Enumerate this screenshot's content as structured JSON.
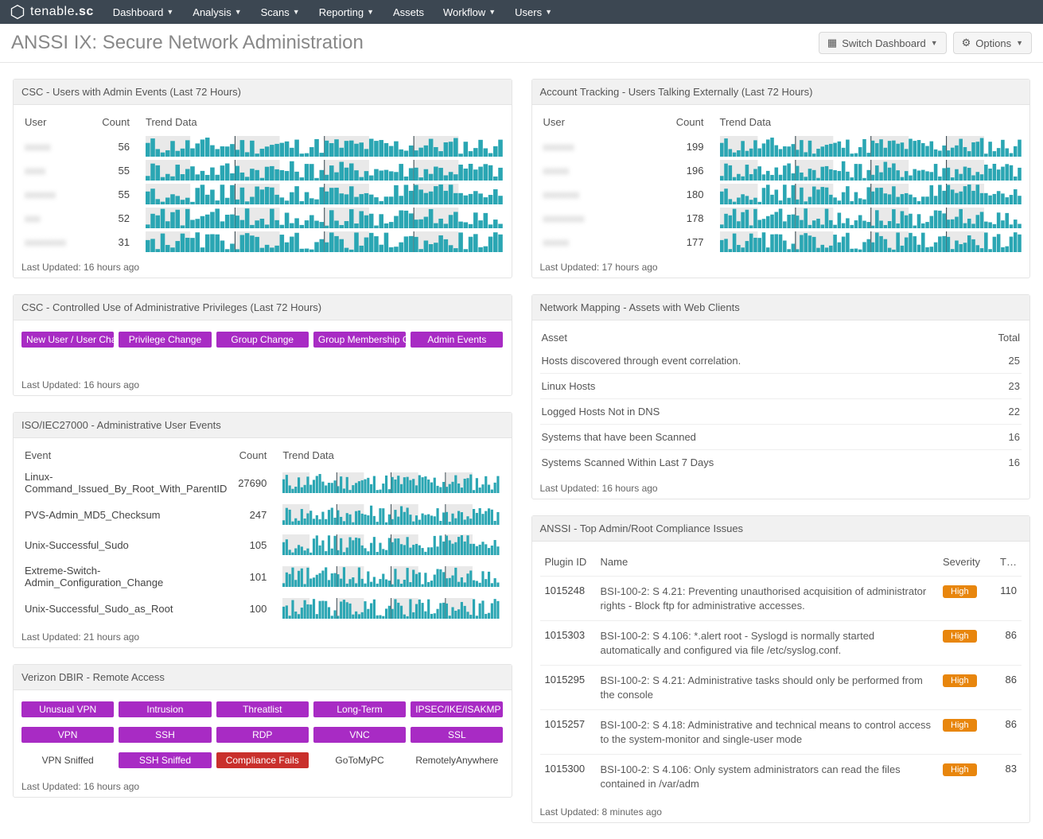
{
  "nav": {
    "brand_prefix": "tenable",
    "brand_suffix": ".sc",
    "items": [
      "Dashboard",
      "Analysis",
      "Scans",
      "Reporting",
      "Assets",
      "Workflow",
      "Users"
    ],
    "items_caret": [
      true,
      true,
      true,
      true,
      false,
      true,
      true
    ]
  },
  "titlebar": {
    "title": "ANSSI IX: Secure Network Administration",
    "switch_label": "Switch Dashboard",
    "options_label": "Options"
  },
  "panels": {
    "csc_admin": {
      "title": "CSC - Users with Admin Events (Last 72 Hours)",
      "headers": [
        "User",
        "Count",
        "Trend Data"
      ],
      "rows": [
        {
          "user": "xxxxx",
          "count": 56
        },
        {
          "user": "xxxx",
          "count": 55
        },
        {
          "user": "xxxxxx",
          "count": 55
        },
        {
          "user": "xxx",
          "count": 52
        },
        {
          "user": "xxxxxxxx",
          "count": 31
        }
      ],
      "last": "Last Updated: 16 hours ago"
    },
    "csc_priv": {
      "title": "CSC - Controlled Use of Administrative Privileges (Last 72 Hours)",
      "pills": [
        "New User / User Change",
        "Privilege Change",
        "Group Change",
        "Group Membership Change",
        "Admin Events"
      ],
      "last": "Last Updated: 16 hours ago"
    },
    "iso": {
      "title": "ISO/IEC27000 - Administrative User Events",
      "headers": [
        "Event",
        "Count",
        "Trend Data"
      ],
      "rows": [
        {
          "event": "Linux-Command_Issued_By_Root_With_ParentID",
          "count": 27690
        },
        {
          "event": "PVS-Admin_MD5_Checksum",
          "count": 247
        },
        {
          "event": "Unix-Successful_Sudo",
          "count": 105
        },
        {
          "event": "Extreme-Switch-Admin_Configuration_Change",
          "count": 101
        },
        {
          "event": "Unix-Successful_Sudo_as_Root",
          "count": 100
        }
      ],
      "last": "Last Updated: 21 hours ago"
    },
    "dbir": {
      "title": "Verizon DBIR - Remote Access",
      "row1": [
        {
          "label": "Unusual VPN",
          "style": "m"
        },
        {
          "label": "Intrusion",
          "style": "m"
        },
        {
          "label": "Threatlist",
          "style": "m"
        },
        {
          "label": "Long-Term",
          "style": "m"
        },
        {
          "label": "IPSEC/IKE/ISAKMP",
          "style": "m"
        }
      ],
      "row2": [
        {
          "label": "VPN",
          "style": "m"
        },
        {
          "label": "SSH",
          "style": "m"
        },
        {
          "label": "RDP",
          "style": "m"
        },
        {
          "label": "VNC",
          "style": "m"
        },
        {
          "label": "SSL",
          "style": "m"
        }
      ],
      "row3": [
        {
          "label": "VPN Sniffed",
          "style": "plain"
        },
        {
          "label": "SSH Sniffed",
          "style": "m"
        },
        {
          "label": "Compliance Fails",
          "style": "red"
        },
        {
          "label": "GoToMyPC",
          "style": "plain"
        },
        {
          "label": "RemotelyAnywhere",
          "style": "plain"
        }
      ],
      "last": "Last Updated: 16 hours ago"
    },
    "tracking": {
      "title": "Account Tracking - Users Talking Externally (Last 72 Hours)",
      "headers": [
        "User",
        "Count",
        "Trend Data"
      ],
      "rows": [
        {
          "user": "xxxxxx",
          "count": 199
        },
        {
          "user": "xxxxx",
          "count": 196
        },
        {
          "user": "xxxxxxx",
          "count": 180
        },
        {
          "user": "xxxxxxxx",
          "count": 178
        },
        {
          "user": "xxxxx",
          "count": 177
        }
      ],
      "last": "Last Updated: 17 hours ago"
    },
    "mapping": {
      "title": "Network Mapping - Assets with Web Clients",
      "headers": [
        "Asset",
        "Total"
      ],
      "rows": [
        {
          "asset": "Hosts discovered through event correlation.",
          "total": 25
        },
        {
          "asset": "Linux Hosts",
          "total": 23
        },
        {
          "asset": "Logged Hosts Not in DNS",
          "total": 22
        },
        {
          "asset": "Systems that have been Scanned",
          "total": 16
        },
        {
          "asset": "Systems Scanned Within Last 7 Days",
          "total": 16
        }
      ],
      "last": "Last Updated: 16 hours ago"
    },
    "compliance": {
      "title": "ANSSI - Top Admin/Root Compliance Issues",
      "headers": [
        "Plugin ID",
        "Name",
        "Severity",
        "T…"
      ],
      "rows": [
        {
          "id": "1015248",
          "name": "BSI-100-2: S 4.21: Preventing unauthorised acquisition of administrator rights - Block ftp for administrative accesses.",
          "sev": "High",
          "t": 110
        },
        {
          "id": "1015303",
          "name": "BSI-100-2: S 4.106: *.alert root - Syslogd is normally started automatically and configured via file /etc/syslog.conf.",
          "sev": "High",
          "t": 86
        },
        {
          "id": "1015295",
          "name": "BSI-100-2: S 4.21: Administrative tasks should only be performed from the console",
          "sev": "High",
          "t": 86
        },
        {
          "id": "1015257",
          "name": "BSI-100-2: S 4.18: Administrative and technical means to control access to the system-monitor and single-user mode",
          "sev": "High",
          "t": 86
        },
        {
          "id": "1015300",
          "name": "BSI-100-2: S 4.106: Only system administrators can read the files contained in /var/adm",
          "sev": "High",
          "t": 83
        }
      ],
      "last": "Last Updated: 8 minutes ago"
    }
  }
}
